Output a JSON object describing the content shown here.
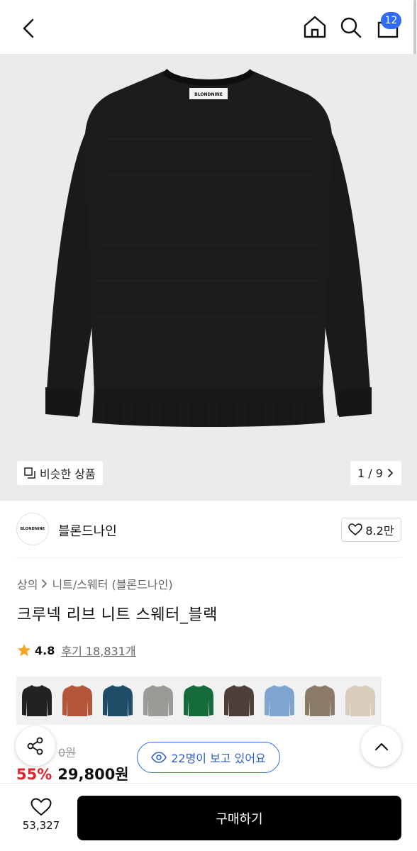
{
  "header": {
    "cart_count": "12",
    "icons": [
      "chevron-left-icon",
      "home-icon",
      "search-icon",
      "bag-icon"
    ]
  },
  "hero": {
    "image_label": "BLONDNINE",
    "similar_label": "비슷한 상품",
    "page_indicator": "1 / 9"
  },
  "brand": {
    "logo_text": "BLONDNINE",
    "name": "블론드나인",
    "likes": "8.2만"
  },
  "product": {
    "breadcrumb": [
      "상의",
      "니트/스웨터 (블론드나인)"
    ],
    "title": "크루넥 리브 니트 스웨터_블랙",
    "rating": "4.8",
    "reviews": "후기 18,831개",
    "swatch_colors": [
      "#222222",
      "#b3563a",
      "#1f4c66",
      "#9a9a96",
      "#156b3c",
      "#4d3f3a",
      "#7ea4d0",
      "#8a7b69",
      "#d8ccbb"
    ],
    "original_price_partial": "0원",
    "discount": "55%",
    "price": "29,800원"
  },
  "viewers_text": "22명이 보고 있어요",
  "bottom": {
    "wish_count": "53,327",
    "buy_label": "구매하기"
  },
  "colors": {
    "accent": "#2f6cf6",
    "discount": "#e0232a",
    "buy_button": "#000000"
  }
}
